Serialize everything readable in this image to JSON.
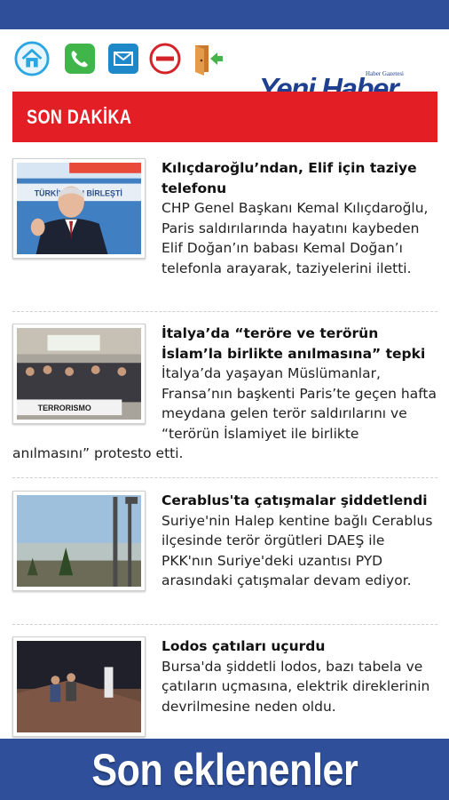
{
  "header": {
    "logo_text": "Yeni Haber",
    "logo_subtext": "Haber Gazetesi",
    "toolbar_icons": [
      "home-icon",
      "phone-icon",
      "mail-icon",
      "no-entry-icon",
      "exit-door-icon"
    ]
  },
  "section": {
    "title": "SON DAKİKA"
  },
  "articles": [
    {
      "title": "Kılıçdaroğlu’ndan, Elif için taziye telefonu",
      "body": "CHP Genel Başkanı Kemal Kılıçdaroğlu, Paris saldırılarında hayatını kaybeden Elif Doğan’ın babası Kemal Doğan’ı telefonla arayarak, taziyelerini iletti.",
      "thumb_banner": "TÜRKİYE'NİN BİRLEŞTİ"
    },
    {
      "title": "İtalya’da “teröre ve terörün İslam’la birlikte anılmasına” tepki",
      "body": "İtalya’da yaşayan Müslümanlar, Fransa’nın başkenti Paris’te geçen hafta meydana gelen terör saldırılarını ve “terörün İslamiyet ile birlikte anılmasını” protesto etti.",
      "thumb_banner": "TERRORISMO"
    },
    {
      "title": "Cerablus'ta çatışmalar şiddetlendi",
      "body": "Suriye'nin Halep kentine bağlı Cerablus ilçesinde terör örgütleri DAEŞ ile PKK'nın Suriye'deki uzantısı PYD arasındaki çatışmalar devam ediyor."
    },
    {
      "title": "Lodos çatıları uçurdu",
      "body": "Bursa'da şiddetli lodos, bazı tabela ve çatıların uçmasına, elektrik direklerinin devrilmesine neden oldu."
    }
  ],
  "footer": {
    "label": "Son eklenenler"
  },
  "colors": {
    "brand_blue": "#2f4f9a",
    "breaking_red": "#e31e24",
    "logo_blue": "#1f3f8f"
  }
}
